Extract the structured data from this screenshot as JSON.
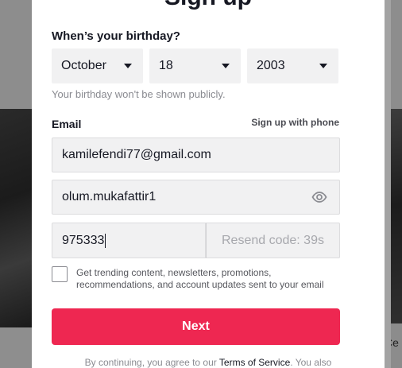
{
  "modal": {
    "title": "Sign up"
  },
  "birthday": {
    "label": "When’s your birthday?",
    "month": "October",
    "day": "18",
    "year": "2003",
    "hint": "Your birthday won't be shown publicly."
  },
  "email": {
    "label": "Email",
    "phone_link": "Sign up with phone",
    "value": "kamilefendi77@gmail.com"
  },
  "password": {
    "value": "olum.mukafattir1",
    "icon": "eye-icon"
  },
  "code": {
    "value": "975333",
    "resend_label": "Resend code: 39s"
  },
  "marketing": {
    "checked": false,
    "text": "Get trending content, newsletters, promotions, recommendations, and account updates sent to your email"
  },
  "next_button": {
    "label": "Next",
    "color": "#ee2751"
  },
  "footer": {
    "prefix": "By continuing, you agree to our ",
    "tos_link": "Terms of Service",
    "suffix": ". You also"
  },
  "background": {
    "right_text": "Çe"
  }
}
